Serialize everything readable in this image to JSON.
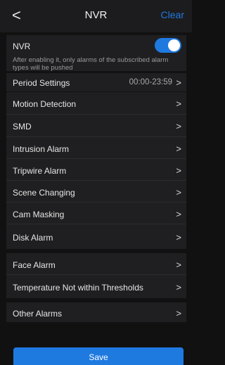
{
  "header": {
    "back_icon": "chevron-left-icon",
    "back_glyph": "<",
    "title": "NVR",
    "clear_label": "Clear"
  },
  "colors": {
    "accent": "#1f7ae0",
    "background": "#111111",
    "row": "#1f1f21"
  },
  "nvr": {
    "label": "NVR",
    "enabled": true,
    "description": "After enabling it, only alarms of the subscribed alarm types will be pushed"
  },
  "chevron_glyph": ">",
  "period": {
    "label": "Period Settings",
    "value": "00:00-23:59"
  },
  "group1": [
    {
      "label": "Motion Detection"
    },
    {
      "label": "SMD"
    },
    {
      "label": "Intrusion Alarm"
    },
    {
      "label": "Tripwire Alarm"
    },
    {
      "label": "Scene Changing"
    },
    {
      "label": "Cam Masking"
    },
    {
      "label": "Disk Alarm"
    }
  ],
  "group2": [
    {
      "label": "Face Alarm"
    },
    {
      "label": "Temperature Not within Thresholds"
    }
  ],
  "group3": [
    {
      "label": "Other Alarms"
    }
  ],
  "save_label": "Save"
}
